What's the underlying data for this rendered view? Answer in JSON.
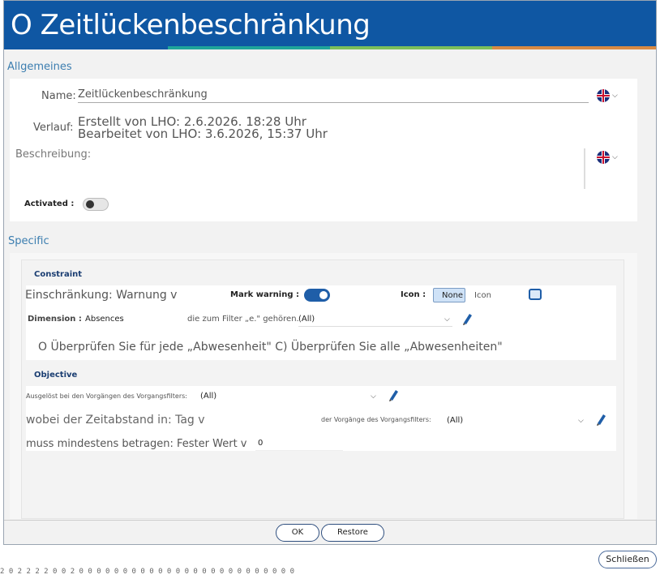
{
  "window": {
    "title": "O Zeitlückenbeschränkung"
  },
  "stripe_colors": [
    "#0f57a3",
    "#1fa59a",
    "#7cbf5a",
    "#d88a44"
  ],
  "general": {
    "section_title": "Allgemeines",
    "name_label": "Name:",
    "name_value": "Zeitlückenbeschränkung",
    "history_label": "Verlauf:",
    "created": "Erstellt von LHO: 2.6.2026. 18:28 Uhr",
    "edited": "Bearbeitet von LHO: 3.6.2026, 15:37 Uhr",
    "description_label": "Beschreibung:",
    "activated_label": "Activated :"
  },
  "specific": {
    "section_title": "Specific",
    "constraint_title": "Constraint",
    "restriction": "Einschränkung: Warnung v",
    "mark_warning_label": "Mark warning :",
    "icon_label": "Icon :",
    "icon_none": "None",
    "icon_option": "Icon",
    "dimension_label": "Dimension :",
    "dimension_value": "Absences",
    "filter_text": "die zum Filter „e.\" gehören.",
    "filter_value": "(All)",
    "check_text": "O Überprüfen Sie für jede „Abwesenheit\" C) Überprüfen Sie alle „Abwesenheiten\"",
    "objective_title": "Objective",
    "triggered_label": "Ausgelöst bei den Vorgängen des Vorgangsfilters:",
    "triggered_value": "(All)",
    "gap_text": "wobei der Zeitabstand in: Tag v",
    "gap_filter_label": "der Vorgänge des Vorgangsfilters:",
    "gap_filter_value": "(All)",
    "min_text": "muss mindestens betragen: Fester Wert v",
    "min_value": "0"
  },
  "buttons": {
    "ok": "OK",
    "restore": "Restore",
    "close": "Schließen"
  },
  "footer_strip": "2  0  2  2  2  2  0  0  2  0  0  0  0  0  0  0  0  0  0  0  0  0  0  0  0  0  0  0  0  0  0  0  0  0"
}
